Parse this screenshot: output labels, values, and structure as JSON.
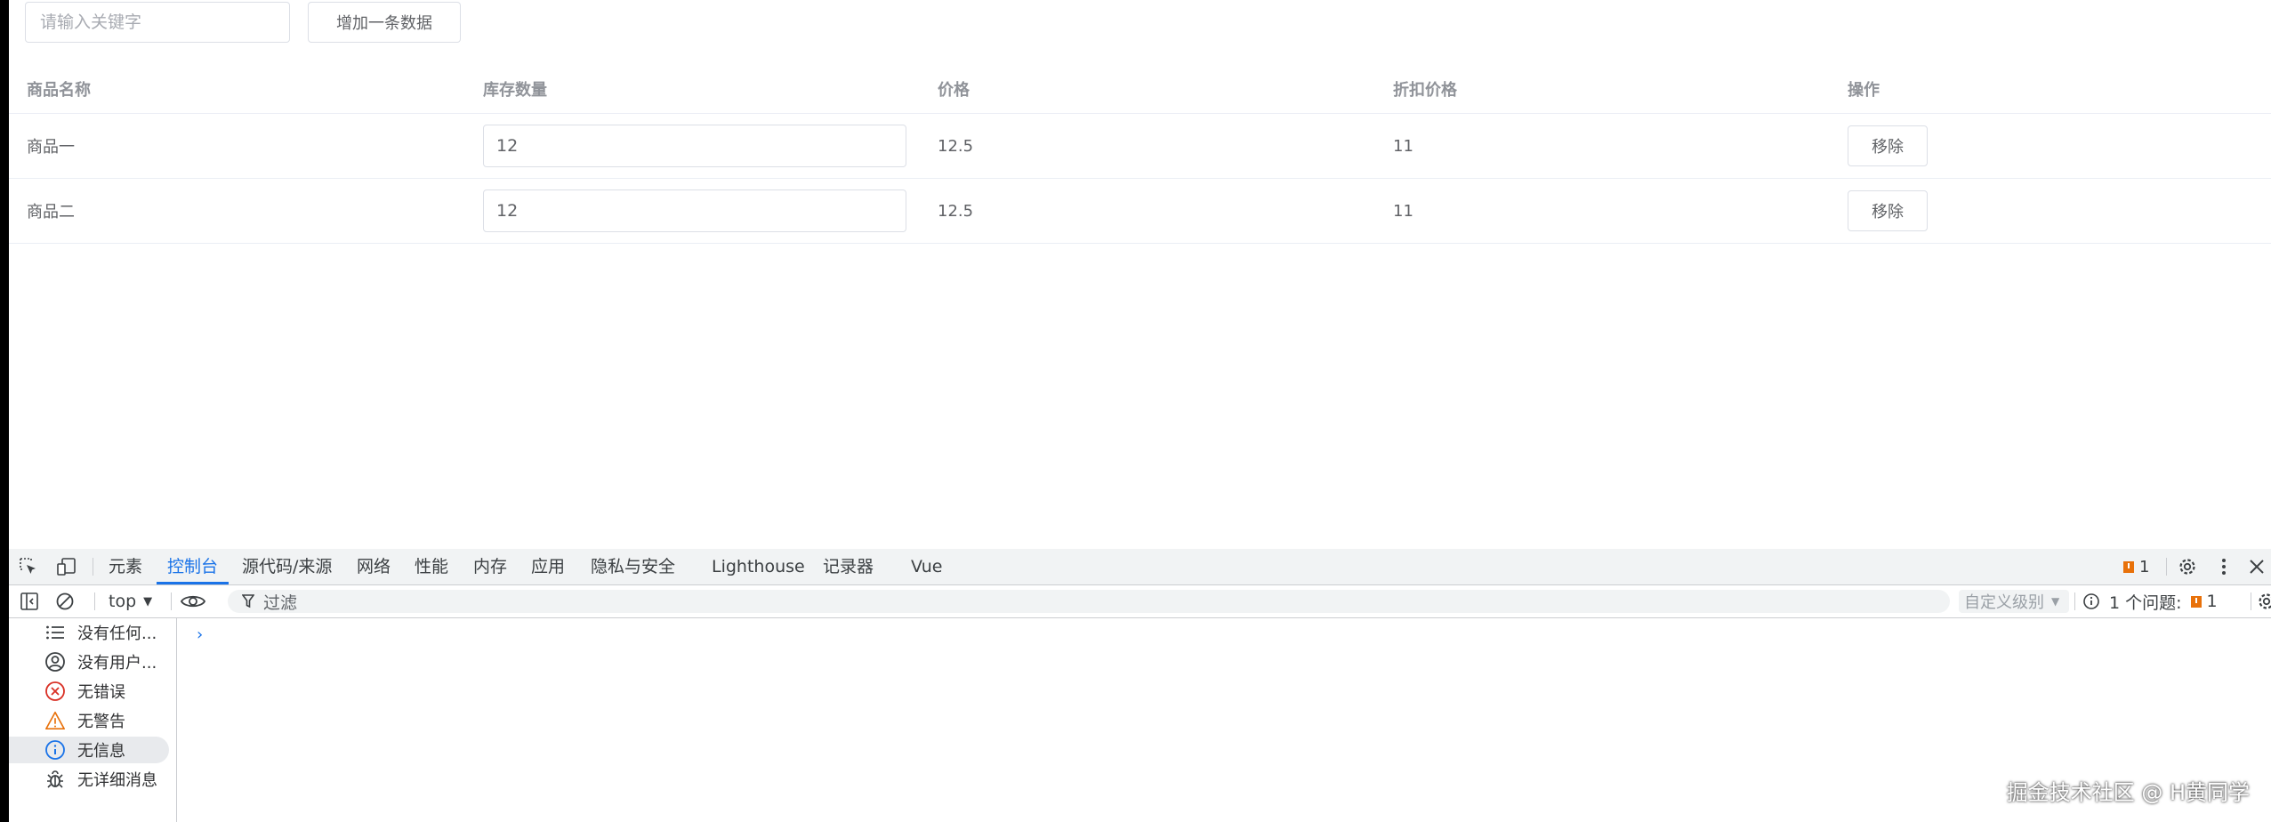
{
  "page": {
    "search_placeholder": "请输入关键字",
    "add_button": "增加一条数据",
    "table": {
      "headers": [
        "商品名称",
        "库存数量",
        "价格",
        "折扣价格",
        "操作"
      ],
      "rows": [
        {
          "name": "商品一",
          "quantity": "12",
          "price": "12.5",
          "discount": "11",
          "action": "移除"
        },
        {
          "name": "商品二",
          "quantity": "12",
          "price": "12.5",
          "discount": "11",
          "action": "移除"
        }
      ]
    }
  },
  "devtools": {
    "tabs": [
      "元素",
      "控制台",
      "源代码/来源",
      "网络",
      "性能",
      "内存",
      "应用",
      "隐私与安全",
      "Lighthouse",
      "记录器",
      "Vue"
    ],
    "active_tab": "控制台",
    "issue_count": "1",
    "context": "top",
    "filter_placeholder": "过滤",
    "level": "自定义级别",
    "issues_label": "1 个问题:",
    "issues_count": "1",
    "sidebar": [
      {
        "label": "没有任何...",
        "icon": "list-icon"
      },
      {
        "label": "没有用户...",
        "icon": "user-icon"
      },
      {
        "label": "无错误",
        "icon": "error-icon"
      },
      {
        "label": "无警告",
        "icon": "warning-icon"
      },
      {
        "label": "无信息",
        "icon": "info-icon"
      },
      {
        "label": "无详细消息",
        "icon": "bug-icon"
      }
    ],
    "prompt": "›"
  },
  "watermark": "掘金技术社区 @ H黄同学",
  "colors": {
    "accent": "#1a73e8",
    "error": "#d93025",
    "warning": "#e8710a",
    "border": "#dcdfe6"
  }
}
